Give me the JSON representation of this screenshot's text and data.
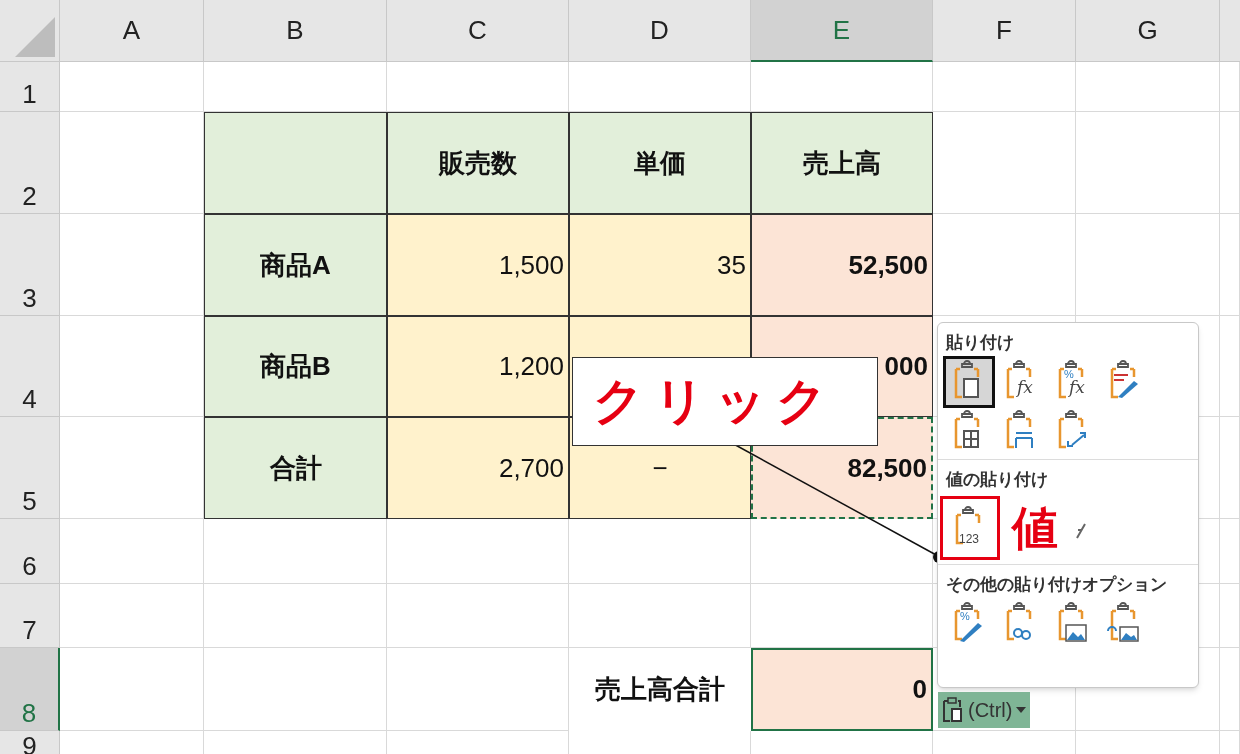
{
  "columns": [
    {
      "label": "A",
      "selected": false
    },
    {
      "label": "B",
      "selected": false
    },
    {
      "label": "C",
      "selected": false
    },
    {
      "label": "D",
      "selected": false
    },
    {
      "label": "E",
      "selected": true
    },
    {
      "label": "F",
      "selected": false
    },
    {
      "label": "G",
      "selected": false
    }
  ],
  "rows": [
    {
      "label": "1",
      "selected": false
    },
    {
      "label": "2",
      "selected": false
    },
    {
      "label": "3",
      "selected": false
    },
    {
      "label": "4",
      "selected": false
    },
    {
      "label": "5",
      "selected": false
    },
    {
      "label": "6",
      "selected": false
    },
    {
      "label": "7",
      "selected": false
    },
    {
      "label": "8",
      "selected": true
    },
    {
      "label": "9",
      "selected": false
    }
  ],
  "table": {
    "header": [
      "販売数",
      "単価",
      "売上高"
    ],
    "rows": [
      {
        "label": "商品A",
        "count": "1,500",
        "price": "35",
        "amount": "52,500",
        "copied": false
      },
      {
        "label": "商品B",
        "count": "1,200",
        "amount": "000",
        "copied": false
      },
      {
        "label": "合計",
        "count": "2,700",
        "price": "−",
        "amount": "82,500",
        "copied": true
      }
    ]
  },
  "total": {
    "label": "売上高合計",
    "value": "0",
    "selected": true
  },
  "paste_menu": {
    "sections": [
      {
        "title": "貼り付け",
        "icons": [
          {
            "kind": "paste",
            "selected": true
          },
          {
            "kind": "formulas",
            "selected": false,
            "label": "fx"
          },
          {
            "kind": "percent",
            "selected": false,
            "mark": "%",
            "label": "fx"
          },
          {
            "kind": "source",
            "selected": false
          },
          {
            "kind": "borderless",
            "selected": false
          },
          {
            "kind": "widths",
            "selected": false
          },
          {
            "kind": "transpose",
            "selected": false
          }
        ]
      },
      {
        "title": "値の貼り付け",
        "icons": [
          {
            "kind": "values",
            "selected": false,
            "label": "123"
          }
        ]
      },
      {
        "title": "その他の貼り付けオプション",
        "icons": [
          {
            "kind": "formatting",
            "selected": false,
            "mark": "%"
          },
          {
            "kind": "link",
            "selected": false
          },
          {
            "kind": "picture",
            "selected": false
          },
          {
            "kind": "linkedpicture",
            "selected": false
          }
        ]
      }
    ],
    "button": "(Ctrl)"
  },
  "callouts": [
    {
      "text": "クリック"
    },
    {
      "text": "値"
    }
  ]
}
